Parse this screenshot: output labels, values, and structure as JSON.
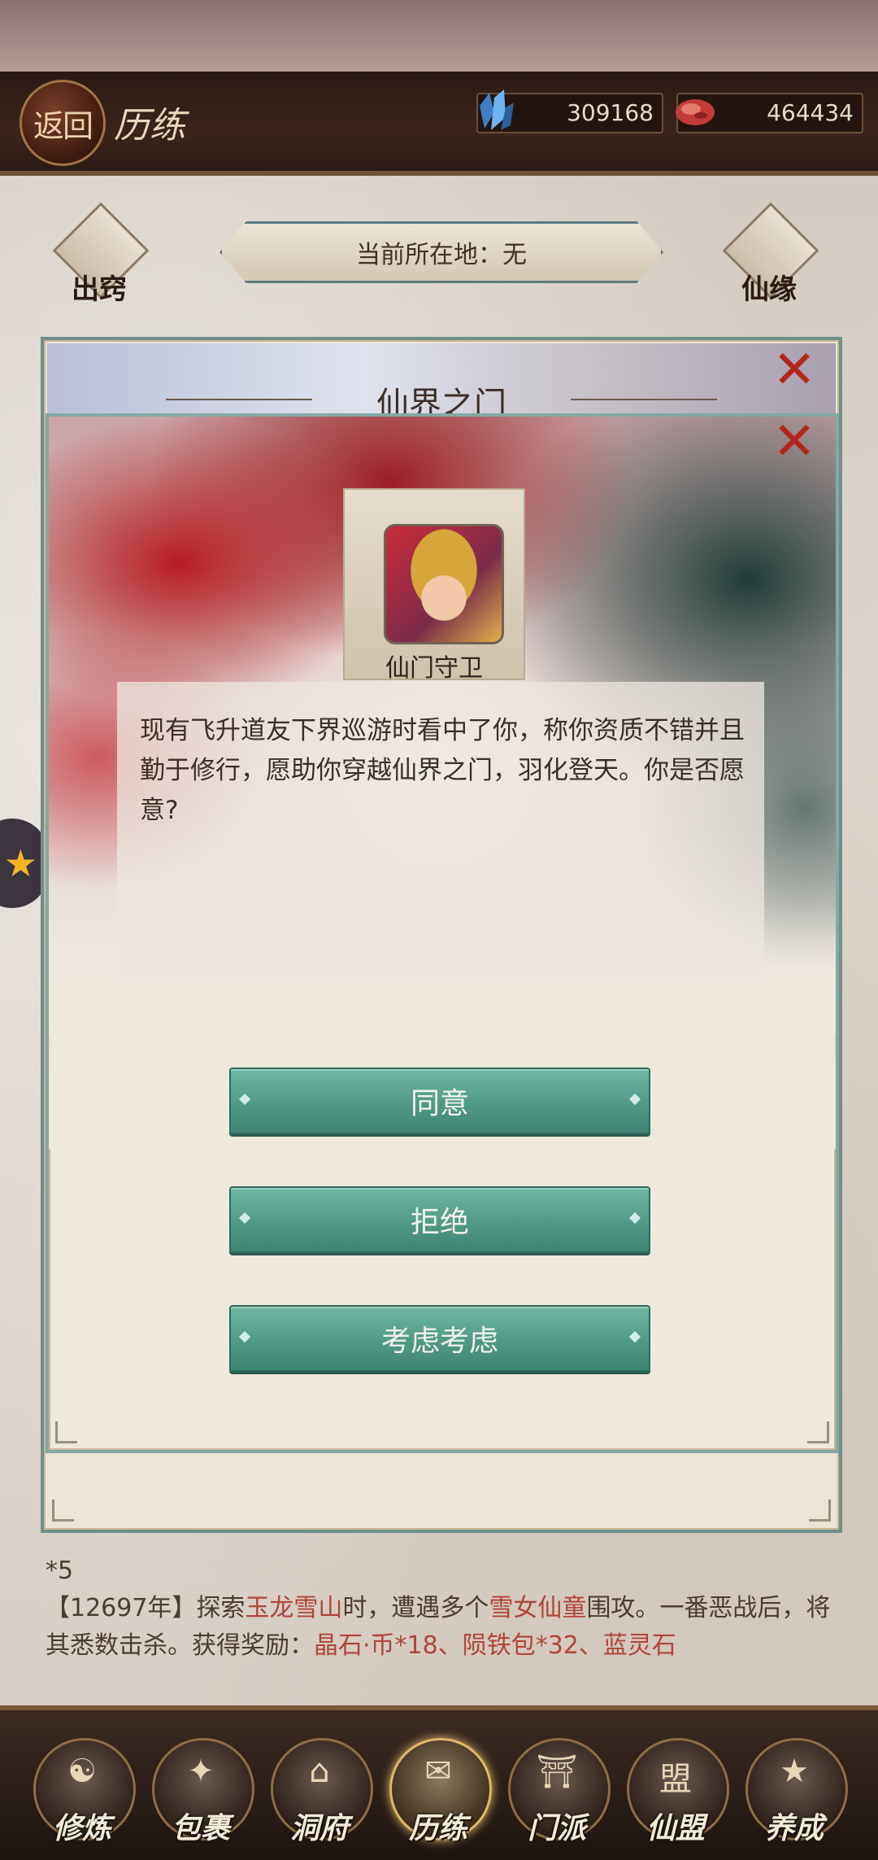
{
  "header": {
    "back_label": "返回",
    "title": "历练",
    "resources": [
      {
        "icon": "crystal-icon",
        "value": "309168"
      },
      {
        "icon": "meat-icon",
        "value": "464434"
      }
    ]
  },
  "location": {
    "text": "当前所在地：无",
    "left_icon_label": "出窍",
    "right_icon_label": "仙缘"
  },
  "back_panel": {
    "title": "仙界之门"
  },
  "dialog": {
    "npc_name": "仙门守卫",
    "message": "现有飞升道友下界巡游时看中了你，称你资质不错并且勤于修行，愿助你穿越仙界之门，羽化登天。你是否愿意?",
    "choices": [
      "同意",
      "拒绝",
      "考虑考虑"
    ]
  },
  "log": {
    "line0": "*5",
    "year": "【12697年】",
    "p1": "探索",
    "place": "玉龙雪山",
    "p2": "时，遭遇多个",
    "enemy": "雪女仙童",
    "p3": "围攻。一番恶战后，将其悉数击杀。获得奖励：",
    "rewards": "晶石·币*18、陨铁包*32、蓝灵石"
  },
  "nav": {
    "items": [
      {
        "label": "修炼",
        "glyph": "☯"
      },
      {
        "label": "包裹",
        "glyph": "✦"
      },
      {
        "label": "洞府",
        "glyph": "⌂"
      },
      {
        "label": "历练",
        "glyph": "✉"
      },
      {
        "label": "门派",
        "glyph": "⛩"
      },
      {
        "label": "仙盟",
        "glyph": "盟"
      },
      {
        "label": "养成",
        "glyph": "★"
      }
    ],
    "active_index": 3
  },
  "colors": {
    "accent_button": "#4f9a86",
    "close_red": "#b3251c",
    "header_bg": "#2a1a14"
  }
}
